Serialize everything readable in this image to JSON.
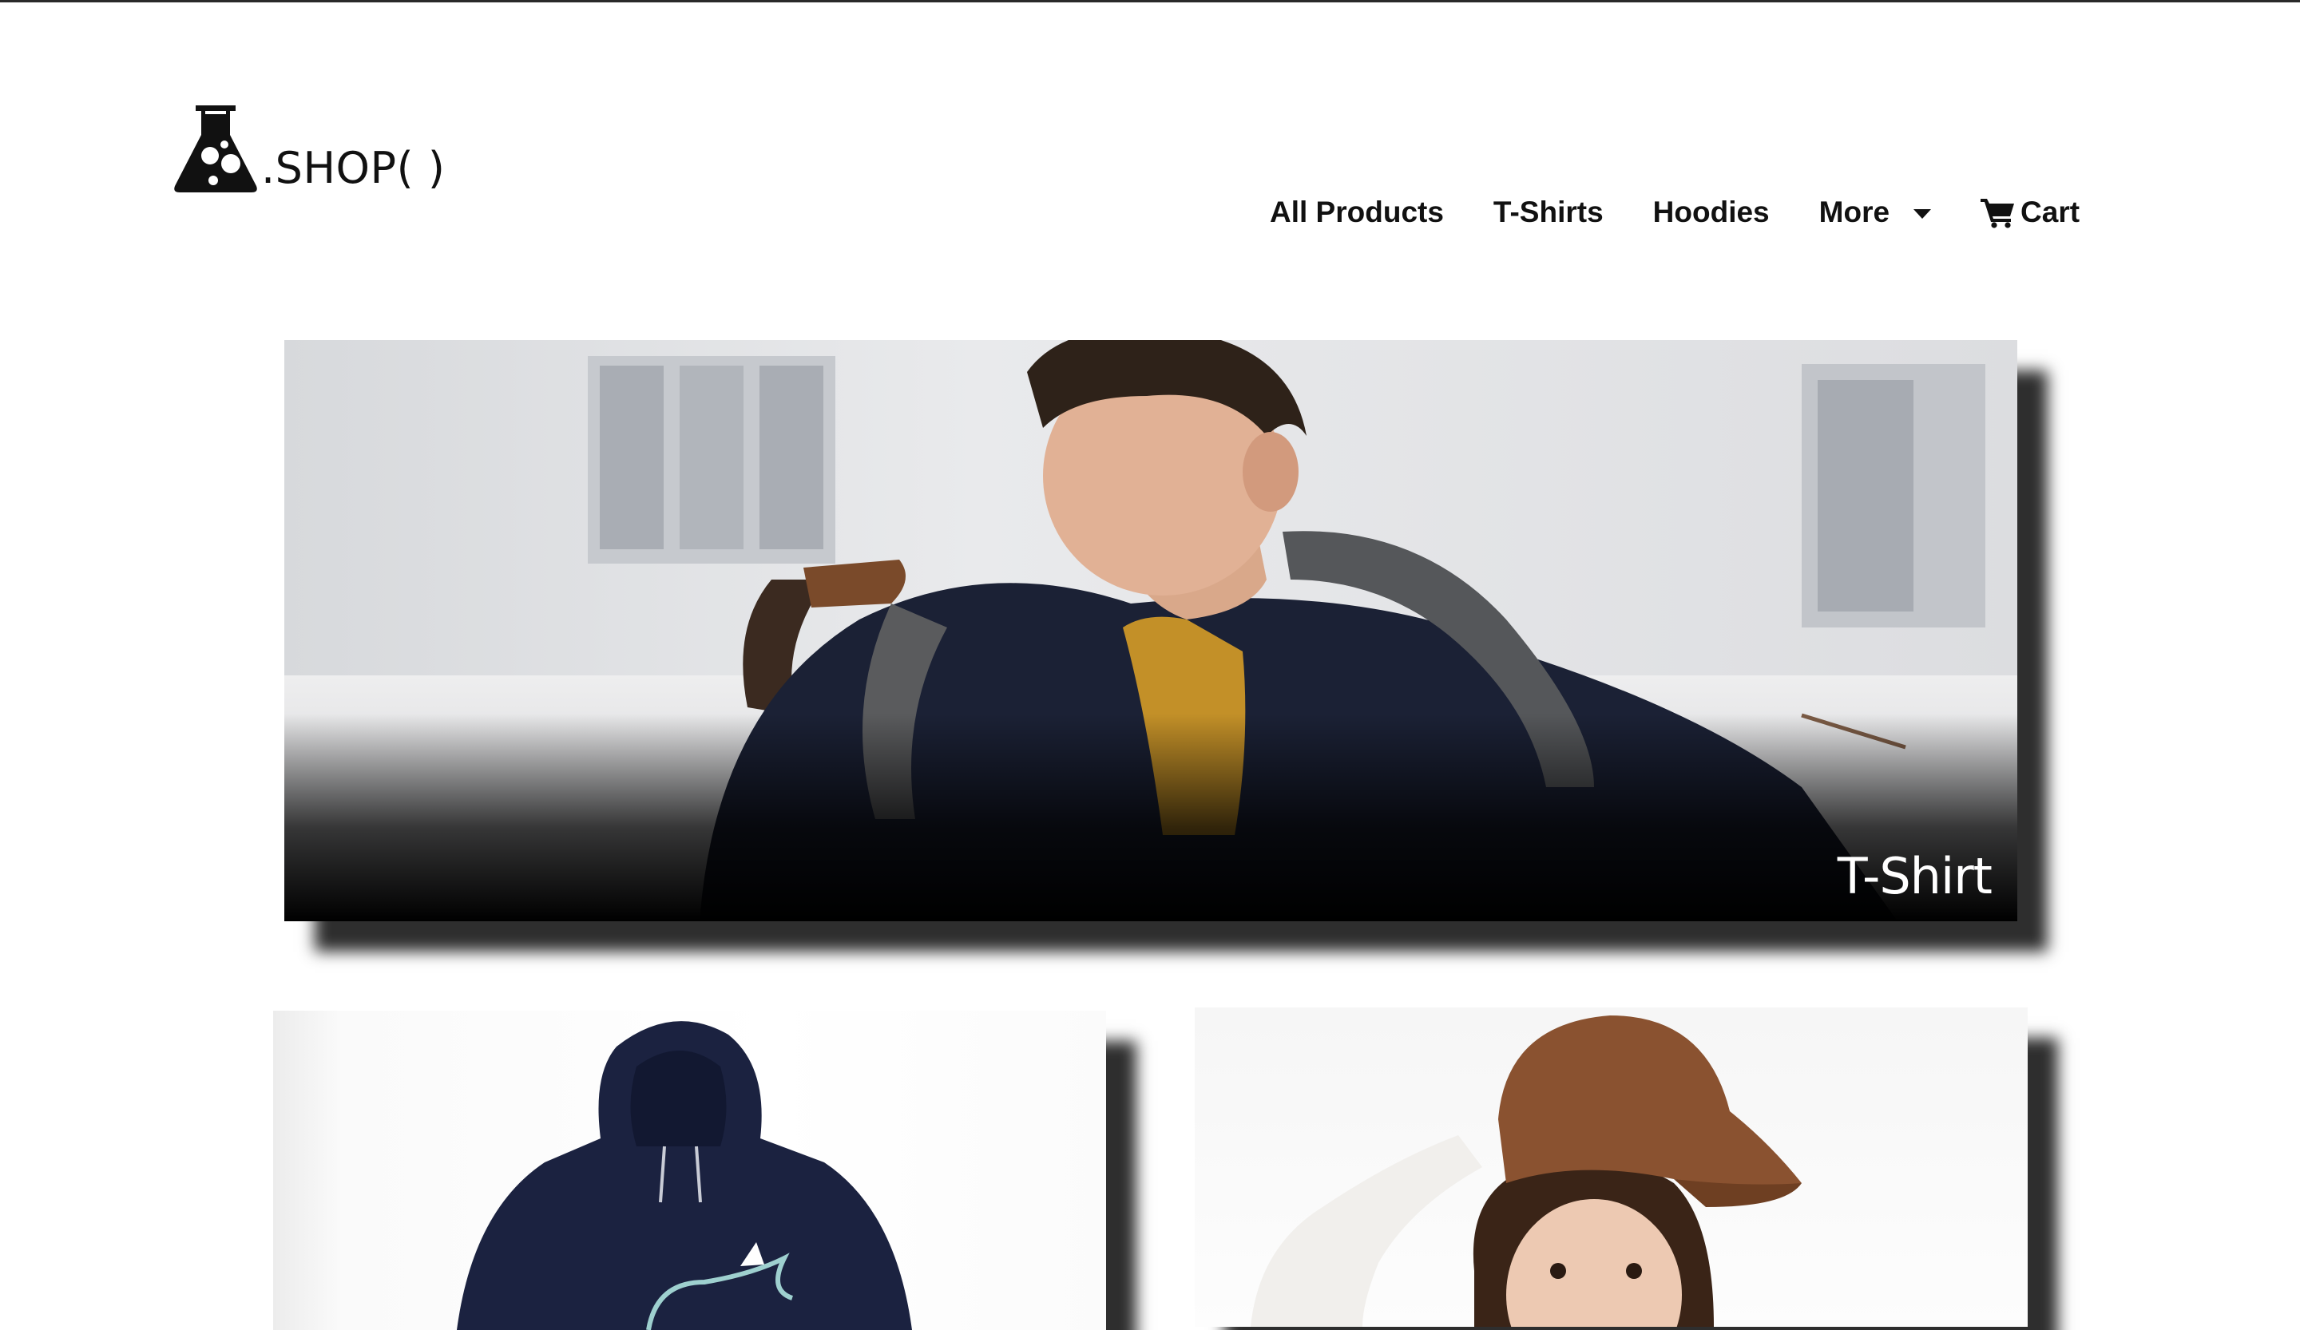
{
  "brand": {
    "name": ".SHOP( )",
    "logo_icon": "flask-icon"
  },
  "nav": {
    "items": [
      {
        "label": "All Products"
      },
      {
        "label": "T-Shirts"
      },
      {
        "label": "Hoodies"
      },
      {
        "label": "More",
        "icon": "caret-down-icon"
      },
      {
        "label": "Cart",
        "icon": "cart-icon"
      }
    ]
  },
  "hero": {
    "caption": "T-Shirt"
  },
  "colors": {
    "text": "#111111",
    "caption": "#ffffff",
    "shadow": "#000000"
  }
}
